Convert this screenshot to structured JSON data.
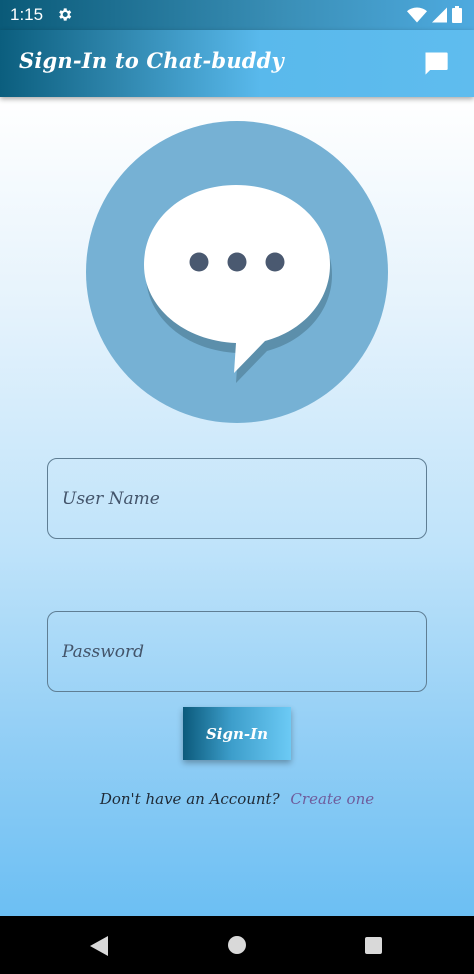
{
  "status_bar": {
    "time": "1:15",
    "icons": [
      "gear-icon",
      "wifi-icon",
      "cellular-signal-icon",
      "battery-icon"
    ]
  },
  "app_bar": {
    "title": "Sign-In to Chat-buddy",
    "action_icon": "chat-bubble-icon"
  },
  "logo": {
    "icon": "chat-bubble-ellipsis-icon",
    "circle_color": "#76b1d4",
    "bubble_color": "#ffffff",
    "dot_color": "#4a5970"
  },
  "form": {
    "username_placeholder": "User Name",
    "username_value": "",
    "password_placeholder": "Password",
    "password_value": "",
    "signin_label": "Sign-In"
  },
  "footer": {
    "question": "Don't have an Account?",
    "link_label": "Create one"
  },
  "nav_bar": {
    "icons": [
      "back-icon",
      "home-icon",
      "recent-apps-icon"
    ]
  },
  "colors": {
    "accent_dark": "#0b5e7e",
    "accent_light": "#5fbcee",
    "link": "#6f5d9c"
  }
}
